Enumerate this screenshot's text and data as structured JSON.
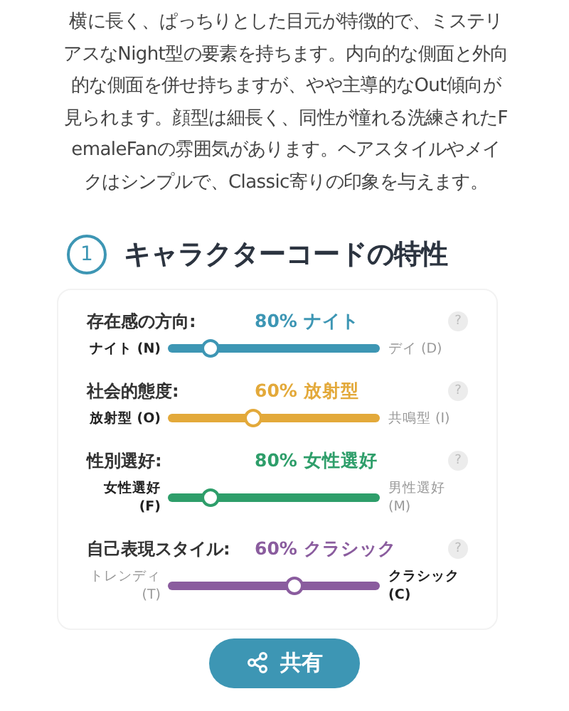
{
  "description": "横に長く、ぱっちりとした目元が特徴的で、ミステリアスなNight型の要素を持ちます。内向的な側面と外向的な側面を併せ持ちますが、やや主導的なOut傾向が見られます。顔型は細長く、同性が憧れる洗練されたFemaleFanの雰囲気があります。ヘアスタイルやメイクはシンプルで、Classic寄りの印象を与えます。",
  "section": {
    "number": "1",
    "title": "キャラクターコードの特性"
  },
  "traits": [
    {
      "label": "存在感の方向:",
      "reading": "80% ナイト",
      "color": "#3d96b4",
      "level": 0.2,
      "left": {
        "label": "ナイト (N)",
        "selected": true
      },
      "right": {
        "label": "デイ (D)",
        "selected": false
      },
      "help": "?"
    },
    {
      "label": "社会的態度:",
      "reading": "60% 放射型",
      "color": "#e3a93a",
      "level": 0.4,
      "left": {
        "label": "放射型 (O)",
        "selected": true
      },
      "right": {
        "label": "共鳴型 (I)",
        "selected": false
      },
      "help": "?"
    },
    {
      "label": "性別選好:",
      "reading": "80% 女性選好",
      "color": "#2e9e6a",
      "level": 0.2,
      "left": {
        "label": "女性選好 (F)",
        "selected": true
      },
      "right": {
        "label": "男性選好 (M)",
        "selected": false
      },
      "help": "?"
    },
    {
      "label": "自己表現スタイル:",
      "reading": "60% クラシック",
      "color": "#8a5c9e",
      "level": 0.6,
      "left": {
        "label": "トレンディ (T)",
        "selected": false
      },
      "right": {
        "label": "クラシック (C)",
        "selected": true
      },
      "help": "?"
    }
  ],
  "share_button": {
    "label": "共有"
  }
}
